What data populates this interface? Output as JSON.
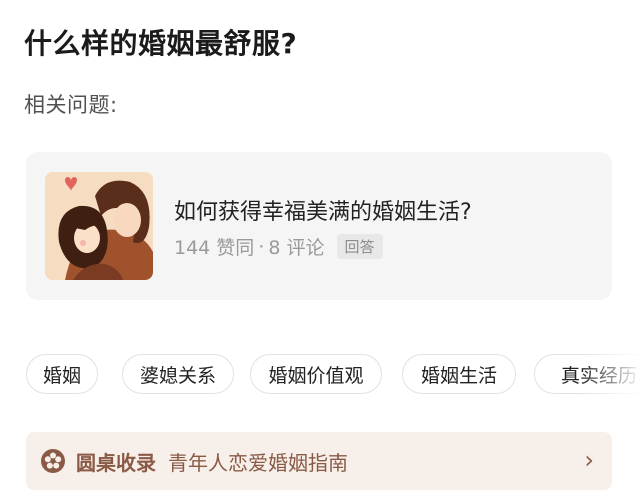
{
  "question": {
    "title": "什么样的婚姻最舒服?"
  },
  "related": {
    "label": "相关问题:",
    "card": {
      "title": "如何获得幸福美满的婚姻生活?",
      "likes": "144 赞同",
      "separator": "·",
      "comments": "8 评论",
      "type_badge": "回答",
      "thumbnail_icon": "couple-illustration-icon"
    }
  },
  "tags": [
    "婚姻",
    "婆媳关系",
    "婚姻价值观",
    "婚姻生活",
    "真实经历"
  ],
  "banner": {
    "icon": "flower-icon",
    "brand": "圆桌收录",
    "text": "青年人恋爱婚姻指南",
    "arrow": "›",
    "color": "#8a5a46",
    "background": "#f7efe9"
  }
}
